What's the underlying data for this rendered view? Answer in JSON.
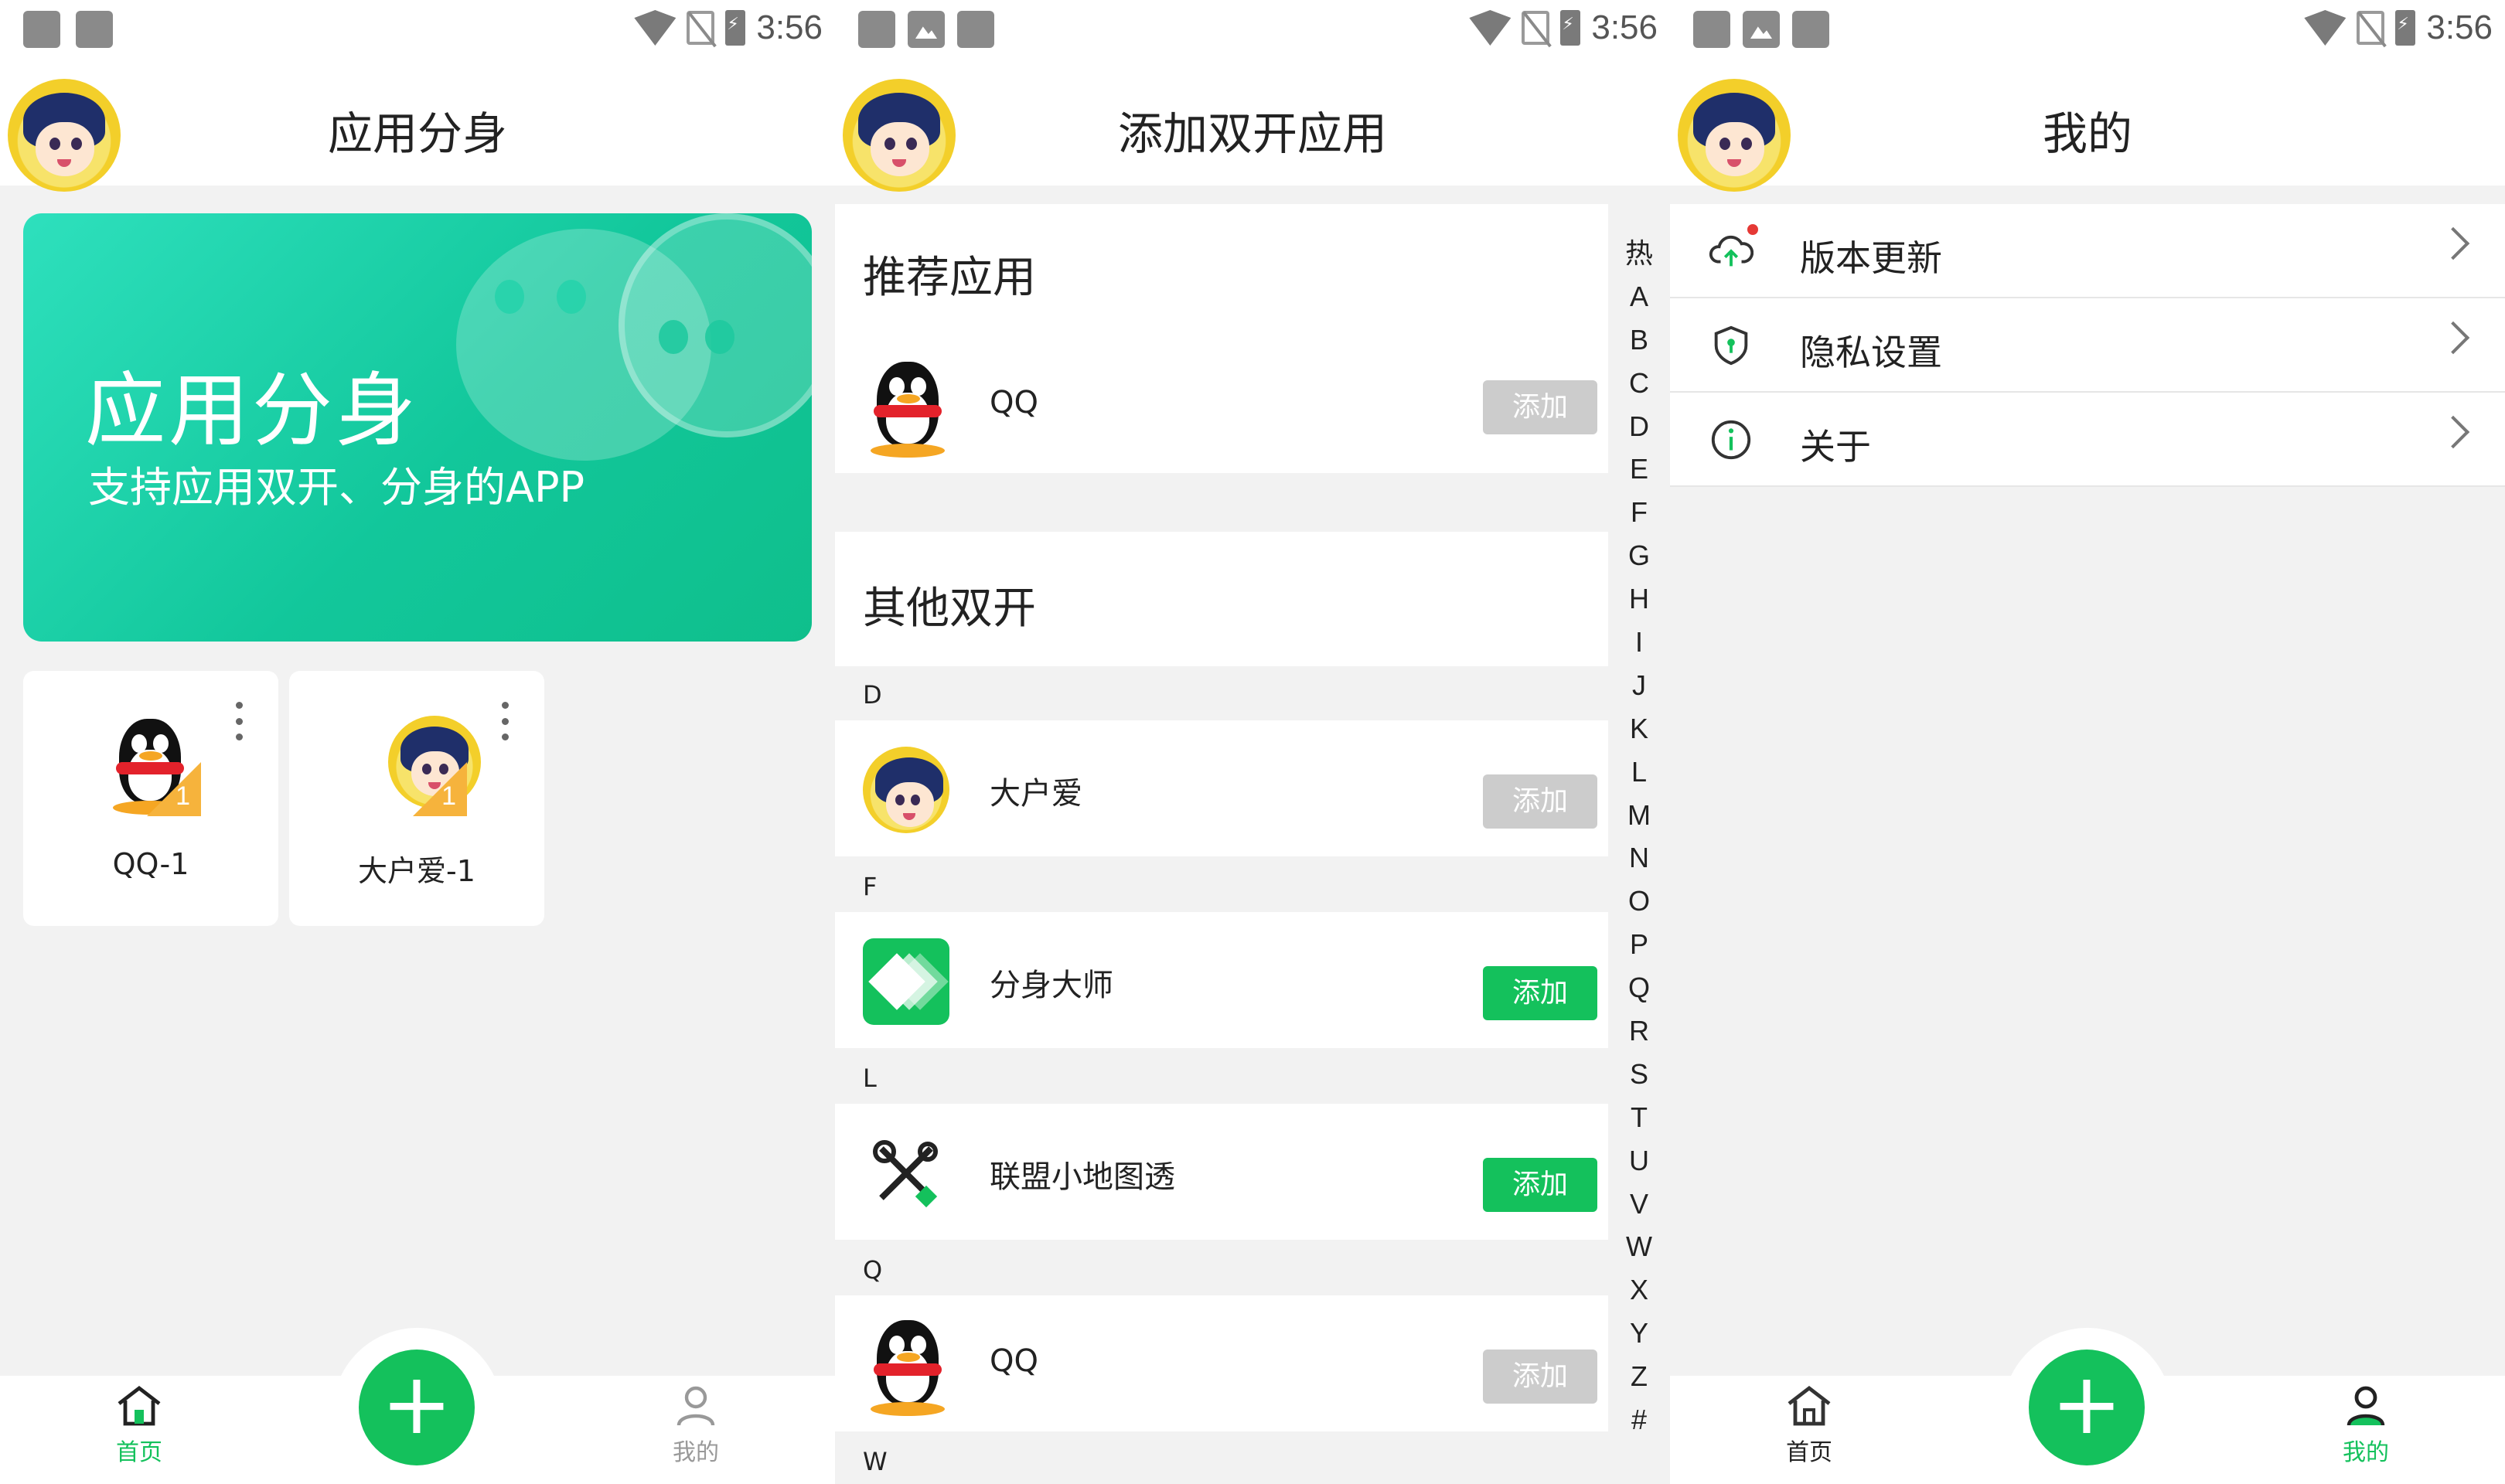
{
  "status_bar": {
    "time": "3:56"
  },
  "screen1": {
    "title": "应用分身",
    "banner": {
      "title": "应用分身",
      "subtitle": "支持应用双开、分身的APP"
    },
    "apps": [
      {
        "name": "QQ-1",
        "badge": "1",
        "icon": "qq-penguin-icon"
      },
      {
        "name": "大户爱-1",
        "badge": "1",
        "icon": "anime-avatar-icon"
      }
    ],
    "nav": {
      "home": "首页",
      "mine": "我的",
      "fab": "+"
    }
  },
  "screen2": {
    "title": "添加双开应用",
    "recommended_title": "推荐应用",
    "recommended": [
      {
        "name": "QQ",
        "button": "添加",
        "enabled": false
      }
    ],
    "others_title": "其他双开",
    "groups": [
      {
        "letter": "D",
        "apps": [
          {
            "name": "大户爱",
            "button": "添加",
            "enabled": false
          }
        ]
      },
      {
        "letter": "F",
        "apps": [
          {
            "name": "分身大师",
            "button": "添加",
            "enabled": true
          }
        ]
      },
      {
        "letter": "L",
        "apps": [
          {
            "name": "联盟小地图透",
            "button": "添加",
            "enabled": true
          }
        ]
      },
      {
        "letter": "Q",
        "apps": [
          {
            "name": "QQ",
            "button": "添加",
            "enabled": false
          }
        ]
      },
      {
        "letter": "W",
        "apps": []
      }
    ],
    "index": [
      "热",
      "A",
      "B",
      "C",
      "D",
      "E",
      "F",
      "G",
      "H",
      "I",
      "J",
      "K",
      "L",
      "M",
      "N",
      "O",
      "P",
      "Q",
      "R",
      "S",
      "T",
      "U",
      "V",
      "W",
      "X",
      "Y",
      "Z",
      "#"
    ]
  },
  "screen3": {
    "title": "我的",
    "menu": [
      {
        "label": "版本更新",
        "icon": "cloud-upload-icon",
        "has_dot": true
      },
      {
        "label": "隐私设置",
        "icon": "shield-icon",
        "has_dot": false
      },
      {
        "label": "关于",
        "icon": "info-icon",
        "has_dot": false
      }
    ],
    "nav": {
      "home": "首页",
      "mine": "我的",
      "fab": "+"
    }
  },
  "colors": {
    "accent": "#14c15c",
    "banner_start": "#2ee0bd",
    "banner_end": "#0fbf8c",
    "disabled": "#cccccc",
    "inactive_nav": "#999999"
  }
}
